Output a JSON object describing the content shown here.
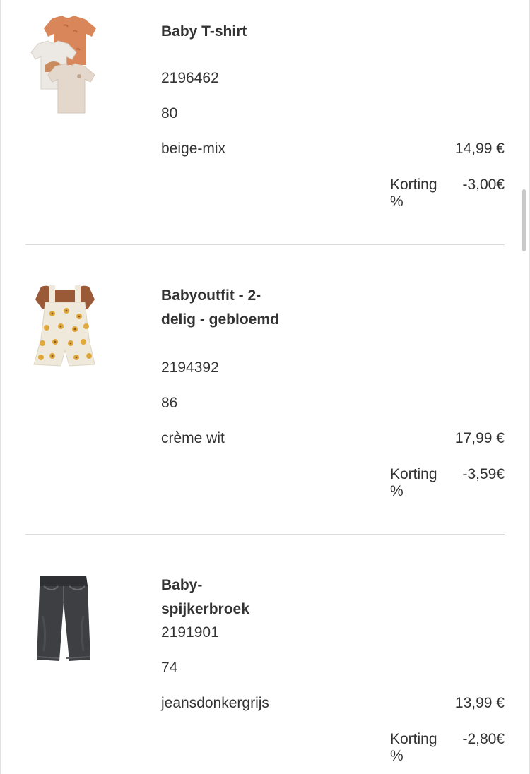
{
  "items": [
    {
      "name": "Baby T-shirt",
      "article": "2196462",
      "size": "80",
      "color": "beige-mix",
      "price": "14,99 €",
      "discount_label": "Korting %",
      "discount_value": "-3,00€",
      "image_icon": "tshirt-set-icon"
    },
    {
      "name": "Babyoutfit - 2-delig - gebloemd",
      "article": "2194392",
      "size": "86",
      "color": "crème wit",
      "price": "17,99 €",
      "discount_label": "Korting %",
      "discount_value": "-3,59€",
      "image_icon": "romper-outfit-icon"
    },
    {
      "name": "Baby-spijkerbroek",
      "article": "2191901",
      "size": "74",
      "color": "jeansdonkergrijs",
      "price": "13,99 €",
      "discount_label": "Korting %",
      "discount_value": "-2,80€",
      "image_icon": "jeans-icon"
    }
  ],
  "colors": {
    "text": "#333333",
    "divider": "#dcdcdc",
    "tshirt_orange": "#d9875a",
    "tshirt_beige": "#e4d8cc",
    "romper_cream": "#efe9dc",
    "romper_brown": "#9a5a38",
    "jeans_dark": "#3e3f42"
  }
}
